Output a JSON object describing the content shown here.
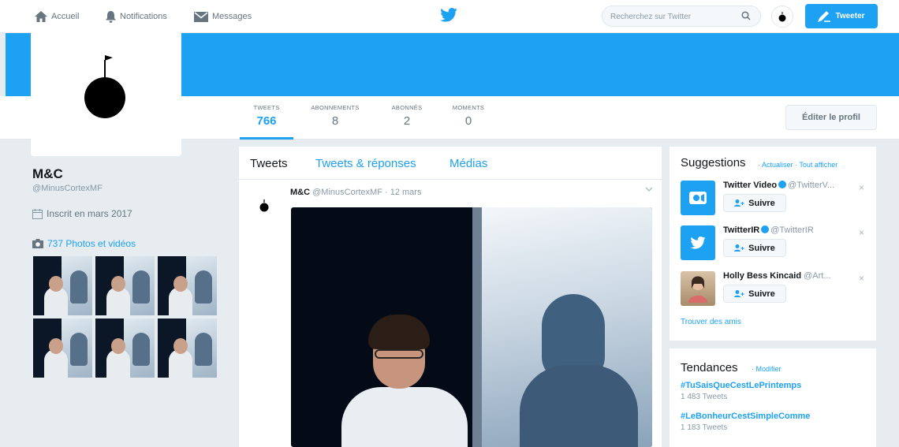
{
  "nav": {
    "home_label": "Accueil",
    "notifications_label": "Notifications",
    "messages_label": "Messages",
    "search_placeholder": "Recherchez sur Twitter",
    "tweet_button_label": "Tweeter"
  },
  "profile_stats": [
    {
      "label": "TWEETS",
      "value": "766"
    },
    {
      "label": "ABONNEMENTS",
      "value": "8"
    },
    {
      "label": "ABONNÉS",
      "value": "2"
    },
    {
      "label": "MOMENTS",
      "value": "0"
    }
  ],
  "edit_profile_label": "Éditer le profil",
  "profile": {
    "name": "M&C",
    "handle": "@MinusCortexMF",
    "joined": "Inscrit en mars 2017",
    "photos_link": "737 Photos et vidéos"
  },
  "timeline": {
    "tabs": [
      "Tweets",
      "Tweets & réponses",
      "Médias"
    ],
    "tweet": {
      "author": "M&C",
      "handle": "@MinusCortexMF",
      "date": "· 12 mars"
    }
  },
  "suggestions": {
    "title": "Suggestions",
    "refresh_label": "Actualiser",
    "separator": "·",
    "show_all_label": "Tout afficher",
    "items": [
      {
        "name": "Twitter Video",
        "handle": "@TwitterV...",
        "follow_label": "Suivre"
      },
      {
        "name": "TwitterIR",
        "handle": "@TwitterIR",
        "follow_label": "Suivre"
      },
      {
        "name": "Holly Bess Kincaid",
        "handle": "@Art...",
        "follow_label": "Suivre"
      }
    ],
    "find_friends": "Trouver des amis",
    "dismiss_glyph": "×"
  },
  "trends": {
    "title": "Tendances",
    "edit_label": "· Modifier",
    "items": [
      {
        "tag": "#TuSaisQueCestLePrintemps",
        "count": "1 483 Tweets"
      },
      {
        "tag": "#LeBonheurCestSimpleComme",
        "count": "1 183 Tweets"
      }
    ]
  },
  "colors": {
    "brand": "#1da1f2",
    "background": "#e6ecf0",
    "muted_text": "#8899a6"
  },
  "icons": [
    "home-icon",
    "bell-icon",
    "envelope-icon",
    "twitter-bird-icon",
    "search-icon",
    "compose-icon",
    "calendar-icon",
    "camera-icon",
    "follow-person-icon",
    "chevron-down-icon"
  ]
}
